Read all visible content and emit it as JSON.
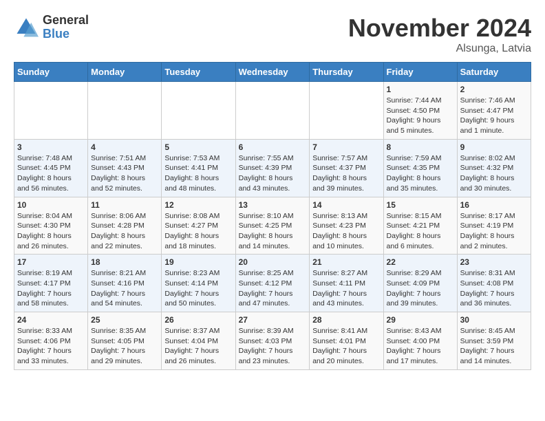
{
  "logo": {
    "general": "General",
    "blue": "Blue"
  },
  "header": {
    "month": "November 2024",
    "location": "Alsunga, Latvia"
  },
  "weekdays": [
    "Sunday",
    "Monday",
    "Tuesday",
    "Wednesday",
    "Thursday",
    "Friday",
    "Saturday"
  ],
  "weeks": [
    [
      {
        "day": "",
        "info": ""
      },
      {
        "day": "",
        "info": ""
      },
      {
        "day": "",
        "info": ""
      },
      {
        "day": "",
        "info": ""
      },
      {
        "day": "",
        "info": ""
      },
      {
        "day": "1",
        "info": "Sunrise: 7:44 AM\nSunset: 4:50 PM\nDaylight: 9 hours\nand 5 minutes."
      },
      {
        "day": "2",
        "info": "Sunrise: 7:46 AM\nSunset: 4:47 PM\nDaylight: 9 hours\nand 1 minute."
      }
    ],
    [
      {
        "day": "3",
        "info": "Sunrise: 7:48 AM\nSunset: 4:45 PM\nDaylight: 8 hours\nand 56 minutes."
      },
      {
        "day": "4",
        "info": "Sunrise: 7:51 AM\nSunset: 4:43 PM\nDaylight: 8 hours\nand 52 minutes."
      },
      {
        "day": "5",
        "info": "Sunrise: 7:53 AM\nSunset: 4:41 PM\nDaylight: 8 hours\nand 48 minutes."
      },
      {
        "day": "6",
        "info": "Sunrise: 7:55 AM\nSunset: 4:39 PM\nDaylight: 8 hours\nand 43 minutes."
      },
      {
        "day": "7",
        "info": "Sunrise: 7:57 AM\nSunset: 4:37 PM\nDaylight: 8 hours\nand 39 minutes."
      },
      {
        "day": "8",
        "info": "Sunrise: 7:59 AM\nSunset: 4:35 PM\nDaylight: 8 hours\nand 35 minutes."
      },
      {
        "day": "9",
        "info": "Sunrise: 8:02 AM\nSunset: 4:32 PM\nDaylight: 8 hours\nand 30 minutes."
      }
    ],
    [
      {
        "day": "10",
        "info": "Sunrise: 8:04 AM\nSunset: 4:30 PM\nDaylight: 8 hours\nand 26 minutes."
      },
      {
        "day": "11",
        "info": "Sunrise: 8:06 AM\nSunset: 4:28 PM\nDaylight: 8 hours\nand 22 minutes."
      },
      {
        "day": "12",
        "info": "Sunrise: 8:08 AM\nSunset: 4:27 PM\nDaylight: 8 hours\nand 18 minutes."
      },
      {
        "day": "13",
        "info": "Sunrise: 8:10 AM\nSunset: 4:25 PM\nDaylight: 8 hours\nand 14 minutes."
      },
      {
        "day": "14",
        "info": "Sunrise: 8:13 AM\nSunset: 4:23 PM\nDaylight: 8 hours\nand 10 minutes."
      },
      {
        "day": "15",
        "info": "Sunrise: 8:15 AM\nSunset: 4:21 PM\nDaylight: 8 hours\nand 6 minutes."
      },
      {
        "day": "16",
        "info": "Sunrise: 8:17 AM\nSunset: 4:19 PM\nDaylight: 8 hours\nand 2 minutes."
      }
    ],
    [
      {
        "day": "17",
        "info": "Sunrise: 8:19 AM\nSunset: 4:17 PM\nDaylight: 7 hours\nand 58 minutes."
      },
      {
        "day": "18",
        "info": "Sunrise: 8:21 AM\nSunset: 4:16 PM\nDaylight: 7 hours\nand 54 minutes."
      },
      {
        "day": "19",
        "info": "Sunrise: 8:23 AM\nSunset: 4:14 PM\nDaylight: 7 hours\nand 50 minutes."
      },
      {
        "day": "20",
        "info": "Sunrise: 8:25 AM\nSunset: 4:12 PM\nDaylight: 7 hours\nand 47 minutes."
      },
      {
        "day": "21",
        "info": "Sunrise: 8:27 AM\nSunset: 4:11 PM\nDaylight: 7 hours\nand 43 minutes."
      },
      {
        "day": "22",
        "info": "Sunrise: 8:29 AM\nSunset: 4:09 PM\nDaylight: 7 hours\nand 39 minutes."
      },
      {
        "day": "23",
        "info": "Sunrise: 8:31 AM\nSunset: 4:08 PM\nDaylight: 7 hours\nand 36 minutes."
      }
    ],
    [
      {
        "day": "24",
        "info": "Sunrise: 8:33 AM\nSunset: 4:06 PM\nDaylight: 7 hours\nand 33 minutes."
      },
      {
        "day": "25",
        "info": "Sunrise: 8:35 AM\nSunset: 4:05 PM\nDaylight: 7 hours\nand 29 minutes."
      },
      {
        "day": "26",
        "info": "Sunrise: 8:37 AM\nSunset: 4:04 PM\nDaylight: 7 hours\nand 26 minutes."
      },
      {
        "day": "27",
        "info": "Sunrise: 8:39 AM\nSunset: 4:03 PM\nDaylight: 7 hours\nand 23 minutes."
      },
      {
        "day": "28",
        "info": "Sunrise: 8:41 AM\nSunset: 4:01 PM\nDaylight: 7 hours\nand 20 minutes."
      },
      {
        "day": "29",
        "info": "Sunrise: 8:43 AM\nSunset: 4:00 PM\nDaylight: 7 hours\nand 17 minutes."
      },
      {
        "day": "30",
        "info": "Sunrise: 8:45 AM\nSunset: 3:59 PM\nDaylight: 7 hours\nand 14 minutes."
      }
    ]
  ]
}
